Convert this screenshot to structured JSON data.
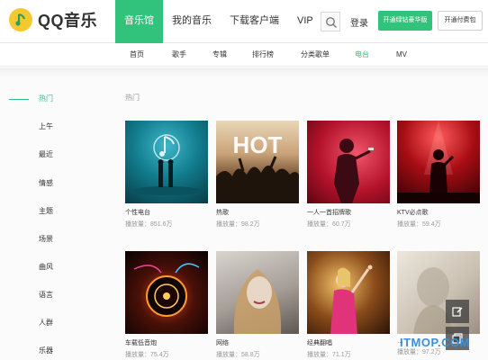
{
  "header": {
    "logo_text": "QQ音乐",
    "nav": [
      "音乐馆",
      "我的音乐",
      "下载客户端",
      "VIP"
    ],
    "login_label": "登录",
    "green_button_label": "开通绿钻豪华版",
    "white_button_label": "开通付费包"
  },
  "subnav": {
    "items": [
      "首页",
      "歌手",
      "专辑",
      "排行榜",
      "分类歌单",
      "电台",
      "MV"
    ],
    "active": "电台"
  },
  "sidebar": {
    "items": [
      "热门",
      "上午",
      "最近",
      "情感",
      "主题",
      "场景",
      "曲风",
      "语言",
      "人群",
      "乐器"
    ],
    "active": "热门"
  },
  "section_title": "热门",
  "cards": [
    {
      "title": "个性电台",
      "plays": "播放量：851.6万"
    },
    {
      "title": "热歌",
      "plays": "播放量：98.2万"
    },
    {
      "title": "一人一首招牌歌",
      "plays": "播放量：60.7万"
    },
    {
      "title": "KTV必点歌",
      "plays": "播放量：59.4万"
    },
    {
      "title": "车载低音炮",
      "plays": "播放量：75.4万"
    },
    {
      "title": "网络",
      "plays": "播放量：58.8万"
    },
    {
      "title": "经典翻唱",
      "plays": "播放量：71.1万"
    },
    {
      "title": "…",
      "plays": "播放量：97.2万"
    }
  ],
  "cover_text": {
    "hot": "HOT"
  },
  "watermark": "ITMOP.COM",
  "colors": {
    "accent": "#31c27c",
    "logo": "#f5c92e"
  },
  "icons": [
    "logo-note-icon",
    "search-icon",
    "edit-icon",
    "copy-icon"
  ]
}
